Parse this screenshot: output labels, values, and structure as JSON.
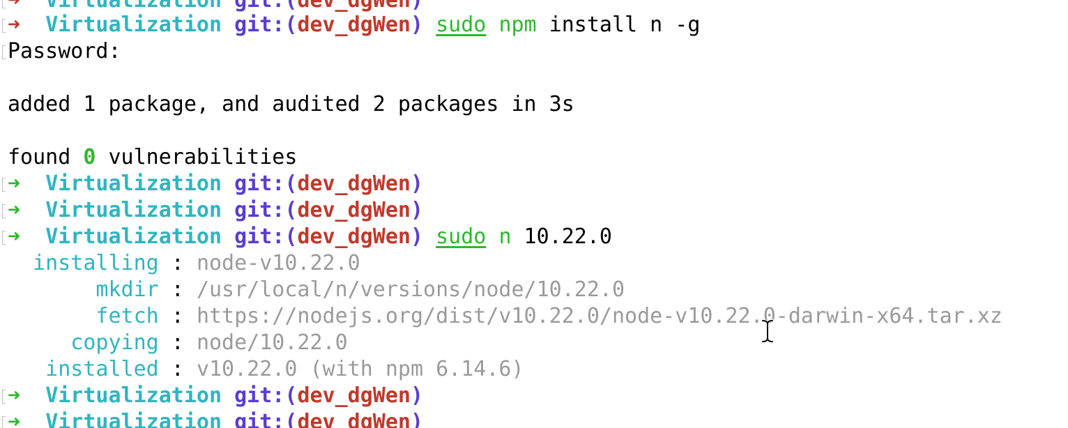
{
  "prompt": {
    "arrow": "➜",
    "directory": "Virtualization",
    "git_label": "git:(",
    "branch": "dev_dgWen",
    "git_close": ")"
  },
  "commands": {
    "npm_install": {
      "sudo": "sudo",
      "program": "npm",
      "args": " install n -g"
    },
    "n_install": {
      "sudo": "sudo",
      "program": "n",
      "args": " 10.22.0"
    }
  },
  "output": {
    "password": "Password:",
    "added": "added 1 package, and audited 2 packages in 3s",
    "found_prefix": "found ",
    "found_count": "0",
    "found_suffix": " vulnerabilities"
  },
  "n_log": [
    {
      "key": "  installing",
      "sep": " : ",
      "value": "node-v10.22.0"
    },
    {
      "key": "       mkdir",
      "sep": " : ",
      "value": "/usr/local/n/versions/node/10.22.0"
    },
    {
      "key": "       fetch",
      "sep": " : ",
      "value": "https://nodejs.org/dist/v10.22.0/node-v10.22.0-darwin-x64.tar.xz"
    },
    {
      "key": "     copying",
      "sep": " : ",
      "value": "node/10.22.0"
    },
    {
      "key": "   installed",
      "sep": " : ",
      "value": "v10.22.0 (with npm 6.14.6)"
    }
  ],
  "colors": {
    "directory": "#2fb5c0",
    "git": "#5b3ccf",
    "branch": "#c0392b",
    "arrow_error": "#c0392b",
    "arrow_ok": "#2eb82e",
    "log_value": "#9a9a9a"
  },
  "cursor_icon": "text-ibeam-cursor-icon"
}
